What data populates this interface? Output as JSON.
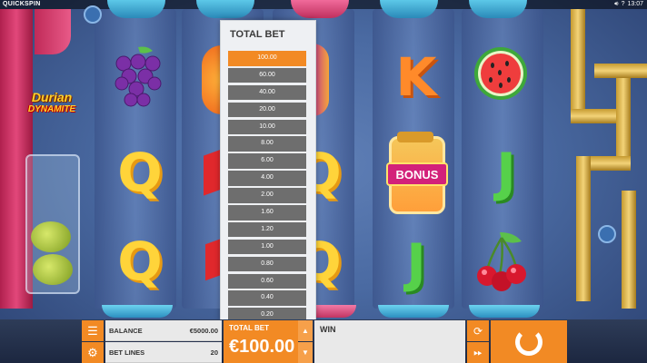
{
  "topbar": {
    "brand": "QUICKSPIN",
    "clock": "13:07",
    "icons": [
      "speaker-icon",
      "help-icon"
    ]
  },
  "game": {
    "logo_line1": "Durian",
    "logo_line2": "DYNAMITE",
    "symbols": {
      "bonus_label": "BONUS",
      "letters": {
        "q": "Q",
        "k": "K",
        "j": "J"
      }
    }
  },
  "bet_panel": {
    "title": "TOTAL BET",
    "options": [
      "100.00",
      "60.00",
      "40.00",
      "20.00",
      "10.00",
      "8.00",
      "6.00",
      "4.00",
      "2.00",
      "1.60",
      "1.20",
      "1.00",
      "0.80",
      "0.60",
      "0.40",
      "0.20"
    ],
    "selected": "100.00"
  },
  "bottom_bar": {
    "balance_label": "BALANCE",
    "balance_value": "€5000.00",
    "bet_lines_label": "BET LINES",
    "bet_lines_value": "20",
    "total_bet_label": "TOTAL BET",
    "total_bet_value": "€100.00",
    "win_label": "WIN",
    "menu_icon": "hamburger-icon",
    "settings_icon": "gear-icon",
    "spin_icon": "spin-arrow-icon"
  },
  "colors": {
    "accent": "#f28a24",
    "bet_item": "#6e6e6e",
    "panel_bg": "#eef0f3"
  }
}
